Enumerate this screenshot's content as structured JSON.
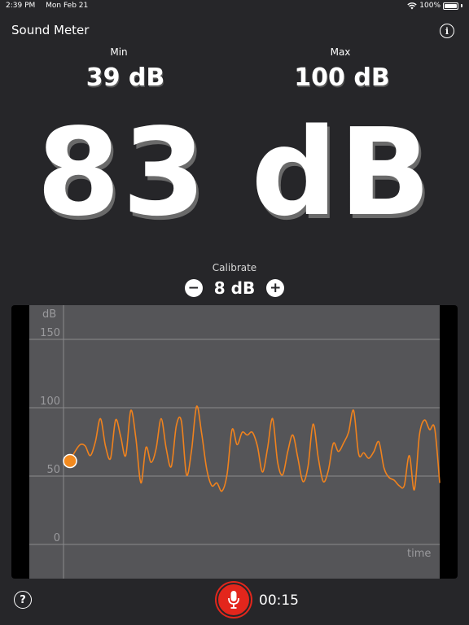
{
  "status_bar": {
    "time": "2:39 PM",
    "date": "Mon Feb 21",
    "battery": "100%"
  },
  "header": {
    "title": "Sound Meter",
    "info_icon": "info-icon"
  },
  "stats": {
    "min_label": "Min",
    "min_value": "39 dB",
    "max_label": "Max",
    "max_value": "100 dB"
  },
  "reading": "83 dB",
  "calibrate": {
    "label": "Calibrate",
    "value": "8 dB",
    "minus": "−",
    "plus": "+"
  },
  "chart_data": {
    "type": "line",
    "ylabel": "dB",
    "xlabel": "time",
    "yticks": [
      "150",
      "100",
      "50",
      "0"
    ],
    "ylim": [
      0,
      150
    ],
    "grid": true,
    "series_color": "#f0821d",
    "current_marker_value": 61,
    "values": [
      61,
      68,
      73,
      72,
      65,
      75,
      92,
      72,
      63,
      91,
      79,
      65,
      98,
      78,
      45,
      71,
      60,
      70,
      92,
      70,
      57,
      87,
      90,
      51,
      69,
      101,
      81,
      55,
      43,
      45,
      39,
      51,
      84,
      73,
      82,
      80,
      82,
      72,
      53,
      70,
      92,
      60,
      51,
      68,
      80,
      63,
      46,
      57,
      88,
      64,
      46,
      54,
      74,
      68,
      74,
      82,
      98,
      66,
      67,
      63,
      68,
      75,
      56,
      49,
      47,
      43,
      43,
      65,
      40,
      80,
      91,
      84,
      85,
      45
    ]
  },
  "footer": {
    "help_label": "?",
    "timer": "00:15",
    "record_color": "#e3261c"
  }
}
